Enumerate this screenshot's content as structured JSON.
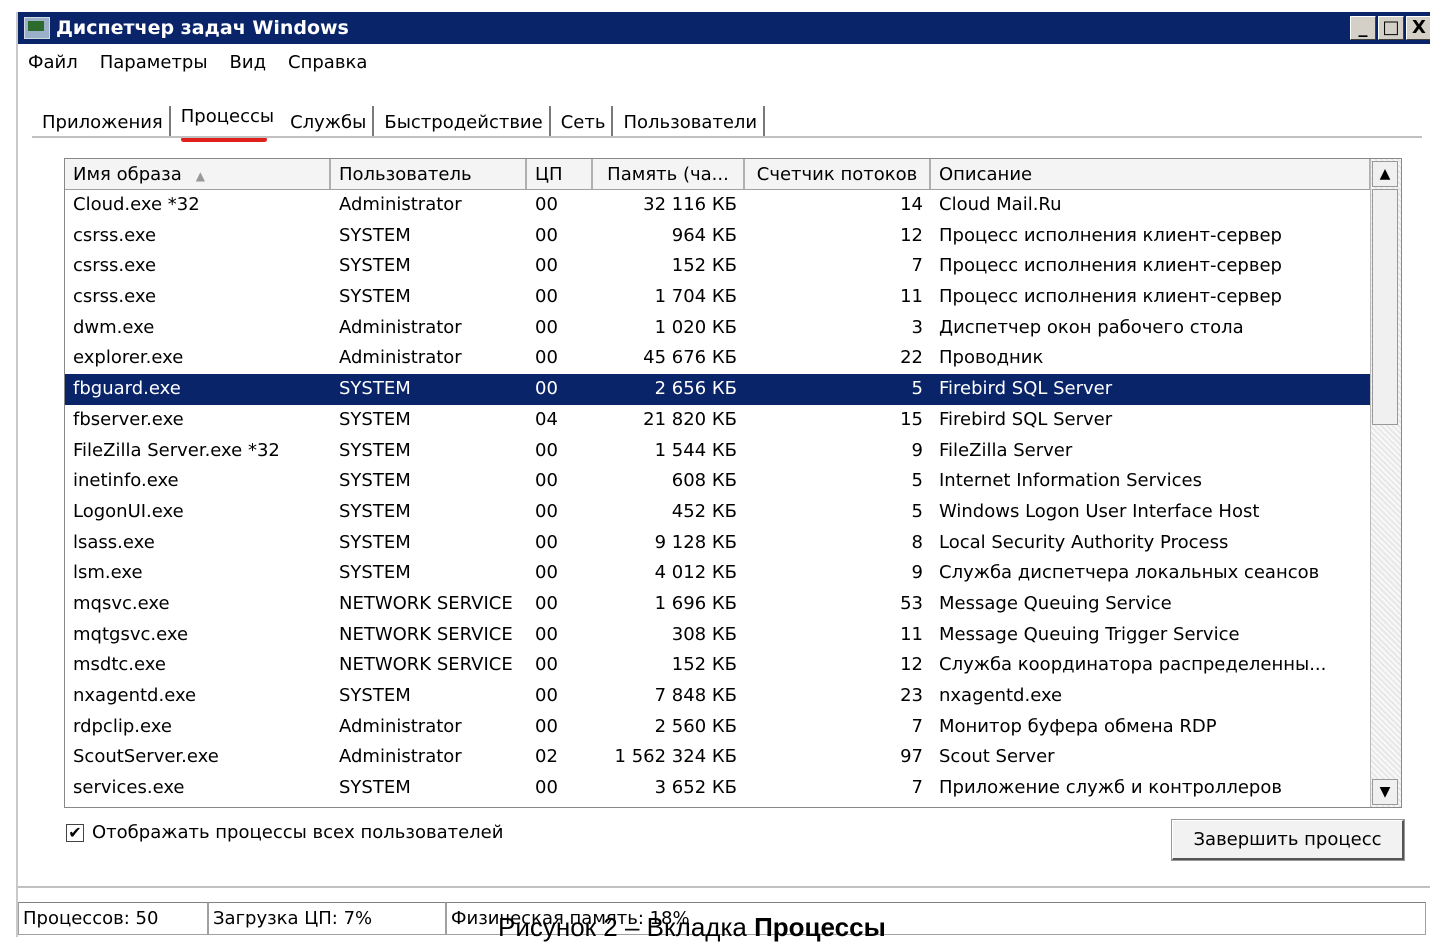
{
  "window": {
    "title": "Диспетчер задач Windows",
    "buttons": {
      "minimize": "_",
      "maximize": "□",
      "close": "X"
    }
  },
  "menu": [
    "Файл",
    "Параметры",
    "Вид",
    "Справка"
  ],
  "tabs": [
    "Приложения",
    "Процессы",
    "Службы",
    "Быстродействие",
    "Сеть",
    "Пользователи"
  ],
  "active_tab": "Процессы",
  "columns": [
    "Имя образа",
    "Пользователь",
    "ЦП",
    "Память (ча...",
    "Счетчик потоков",
    "Описание"
  ],
  "sort_indicator": "▲",
  "rows": [
    [
      "Cloud.exe *32",
      "Administrator",
      "00",
      "32 116 КБ",
      "14",
      "Cloud Mail.Ru"
    ],
    [
      "csrss.exe",
      "SYSTEM",
      "00",
      "964 КБ",
      "12",
      "Процесс исполнения клиент-сервер"
    ],
    [
      "csrss.exe",
      "SYSTEM",
      "00",
      "152 КБ",
      "7",
      "Процесс исполнения клиент-сервер"
    ],
    [
      "csrss.exe",
      "SYSTEM",
      "00",
      "1 704 КБ",
      "11",
      "Процесс исполнения клиент-сервер"
    ],
    [
      "dwm.exe",
      "Administrator",
      "00",
      "1 020 КБ",
      "3",
      "Диспетчер окон рабочего стола"
    ],
    [
      "explorer.exe",
      "Administrator",
      "00",
      "45 676 КБ",
      "22",
      "Проводник"
    ],
    [
      "fbguard.exe",
      "SYSTEM",
      "00",
      "2 656 КБ",
      "5",
      "Firebird SQL Server"
    ],
    [
      "fbserver.exe",
      "SYSTEM",
      "04",
      "21 820 КБ",
      "15",
      "Firebird SQL Server"
    ],
    [
      "FileZilla Server.exe *32",
      "SYSTEM",
      "00",
      "1 544 КБ",
      "9",
      "FileZilla Server"
    ],
    [
      "inetinfo.exe",
      "SYSTEM",
      "00",
      "608 КБ",
      "5",
      "Internet Information Services"
    ],
    [
      "LogonUI.exe",
      "SYSTEM",
      "00",
      "452 КБ",
      "5",
      "Windows Logon User Interface Host"
    ],
    [
      "lsass.exe",
      "SYSTEM",
      "00",
      "9 128 КБ",
      "8",
      "Local Security Authority Process"
    ],
    [
      "lsm.exe",
      "SYSTEM",
      "00",
      "4 012 КБ",
      "9",
      "Служба диспетчера локальных сеансов"
    ],
    [
      "mqsvc.exe",
      "NETWORK SERVICE",
      "00",
      "1 696 КБ",
      "53",
      "Message Queuing Service"
    ],
    [
      "mqtgsvc.exe",
      "NETWORK SERVICE",
      "00",
      "308 КБ",
      "11",
      "Message Queuing Trigger Service"
    ],
    [
      "msdtc.exe",
      "NETWORK SERVICE",
      "00",
      "152 КБ",
      "12",
      "Служба координатора распределенны..."
    ],
    [
      "nxagentd.exe",
      "SYSTEM",
      "00",
      "7 848 КБ",
      "23",
      "nxagentd.exe"
    ],
    [
      "rdpclip.exe",
      "Administrator",
      "00",
      "2 560 КБ",
      "7",
      "Монитор буфера обмена RDP"
    ],
    [
      "ScoutServer.exe",
      "Administrator",
      "02",
      "1 562 324 КБ",
      "97",
      "Scout Server"
    ],
    [
      "services.exe",
      "SYSTEM",
      "00",
      "3 652 КБ",
      "7",
      "Приложение служб и контроллеров"
    ]
  ],
  "selected_row": "fbguard.exe",
  "show_all_checkbox": {
    "label": "Отображать процессы всех пользователей",
    "checked": true,
    "mark": "✔"
  },
  "end_process_button": "Завершить процесс",
  "scrollbar": {
    "up": "▲",
    "down": "▼"
  },
  "status": {
    "processes": "Процессов: 50",
    "cpu": "Загрузка ЦП: 7%",
    "memory": "Физическая память: 18%"
  },
  "caption": {
    "prefix": "Рисунок 2 – Вкладка ",
    "bold": "Процессы"
  }
}
